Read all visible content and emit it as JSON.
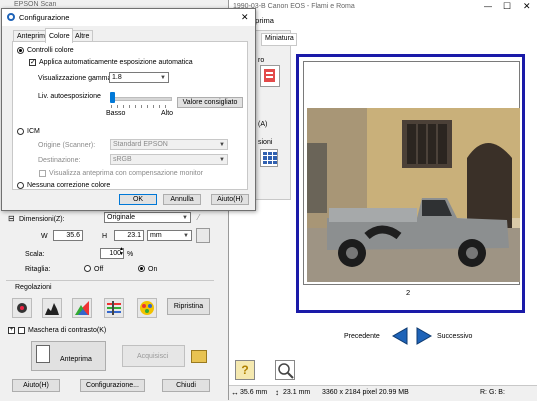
{
  "main_window": {
    "title": "EPSON Scan",
    "dim_label": "Dimensioni(Z):",
    "dim_value": "Originale",
    "w_label": "W",
    "w_value": "35.6",
    "h_label": "H",
    "h_value": "23.1",
    "unit_value": "mm",
    "scale_label": "Scala:",
    "scale_value": "100",
    "scale_unit": "%",
    "crop_label": "Ritaglia:",
    "crop_off": "Off",
    "crop_on": "On",
    "adjust_label": "Regolazioni",
    "reset_button": "Ripristina",
    "mask_label": "Maschera di contrasto(K)",
    "preview_button": "Anteprima",
    "acquire_button": "Acquisisci",
    "help_button": "Aiuto(H)",
    "config_button": "Configurazione...",
    "close_button": "Chiudi"
  },
  "preview_window": {
    "title": "1990-03-B Canon EOS - Flami e Roma",
    "title_short": "eprima",
    "tab_thumbnails": "Miniatura",
    "side_label_1": "ro",
    "side_label_2": "(A)",
    "side_label_3": "sioni",
    "frame_number": "2",
    "prev_label": "Precedente",
    "next_label": "Successivo",
    "status_w": "35.6 mm",
    "status_h": "23.1 mm",
    "status_pixels": "3360 x 2184 pixel 20.99 MB",
    "status_rgb": "R: G: B:"
  },
  "dialog": {
    "title": "Configurazione",
    "tabs": [
      "Anteprima",
      "Colore",
      "Altre"
    ],
    "active_tab": "Colore",
    "color_controls_label": "Controlli colore",
    "auto_exposure_label": "Applica automaticamente esposizione automatica",
    "gamma_label": "Visualizzazione gamma:",
    "gamma_value": "1.8",
    "auto_exposure_level_label": "Liv. autoesposizione",
    "slider_low": "Basso",
    "slider_high": "Alto",
    "slider_value": 0.0,
    "recommended_button": "Valore consigliato",
    "icm_label": "ICM",
    "source_label": "Origine (Scanner):",
    "source_value": "Standard EPSON",
    "dest_label": "Destinazione:",
    "dest_value": "sRGB",
    "monitor_comp_label": "Visualizza anteprima con compensazione monitor",
    "no_correction_label": "Nessuna correzione colore",
    "ok_button": "OK",
    "cancel_button": "Annulla",
    "help_button": "Aiuto(H)"
  }
}
